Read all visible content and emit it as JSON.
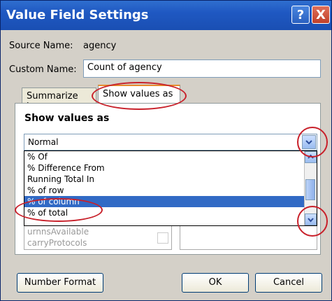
{
  "window": {
    "title": "Value Field Settings"
  },
  "titlebar": {
    "help_glyph": "?",
    "close_glyph": "X"
  },
  "source": {
    "label": "Source Name:",
    "value": "agency"
  },
  "custom": {
    "label": "Custom Name:",
    "value": "Count of agency"
  },
  "tabs": [
    {
      "label": "Summarize by"
    },
    {
      "label": "Show values as"
    }
  ],
  "section": {
    "title": "Show values as"
  },
  "combo": {
    "selected": "Normal"
  },
  "list": {
    "items": [
      "% Of",
      "% Difference From",
      "Running Total In",
      "% of row",
      "% of column",
      "% of total"
    ],
    "selected_index": 4
  },
  "hidden_list": {
    "items": [
      "urnnsAvailable",
      "carryProtocols"
    ]
  },
  "buttons": {
    "number_format": "Number Format",
    "ok": "OK",
    "cancel": "Cancel"
  },
  "colors": {
    "titlebar": "#1f58c2",
    "highlight": "#316ac5",
    "annotation": "#c8202a"
  }
}
